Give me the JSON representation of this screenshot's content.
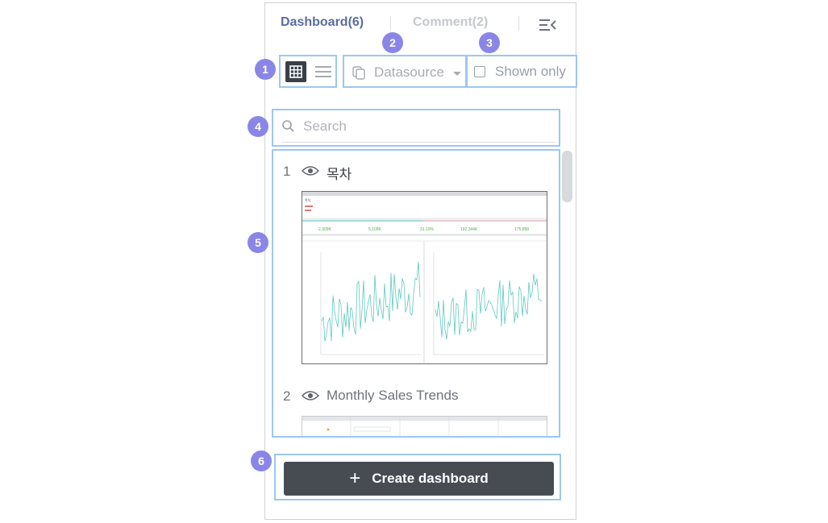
{
  "tabs": [
    {
      "label": "Dashboard(6)",
      "active": true
    },
    {
      "label": "Comment(2)",
      "active": false
    }
  ],
  "toolbar": {
    "datasource_label": "Datasource",
    "shown_only_label": "Shown only",
    "shown_only_checked": false
  },
  "search": {
    "placeholder": "Search",
    "value": ""
  },
  "dashboards": [
    {
      "number": "1",
      "title": "목차",
      "visible": true
    },
    {
      "number": "2",
      "title": "Monthly Sales Trends",
      "visible": true
    }
  ],
  "thumbnail": {
    "kpis": [
      "2,309K",
      "5,109K",
      "31.10%",
      "192,344K",
      "175,898"
    ]
  },
  "create_button": {
    "label": "Create dashboard"
  },
  "callouts": [
    "1",
    "2",
    "3",
    "4",
    "5",
    "6"
  ],
  "colors": {
    "accent": "#5b6d9e",
    "highlight": "#9bc8ef",
    "badge": "#8a86e8",
    "button": "#474b52",
    "chart_line": "#5fc9c0",
    "kpi_green": "#4caf50"
  },
  "icons": [
    "grid-view-icon",
    "list-view-icon",
    "datasource-icon",
    "caret-down-icon",
    "search-icon",
    "eye-icon",
    "collapse-panel-icon",
    "plus-icon"
  ]
}
